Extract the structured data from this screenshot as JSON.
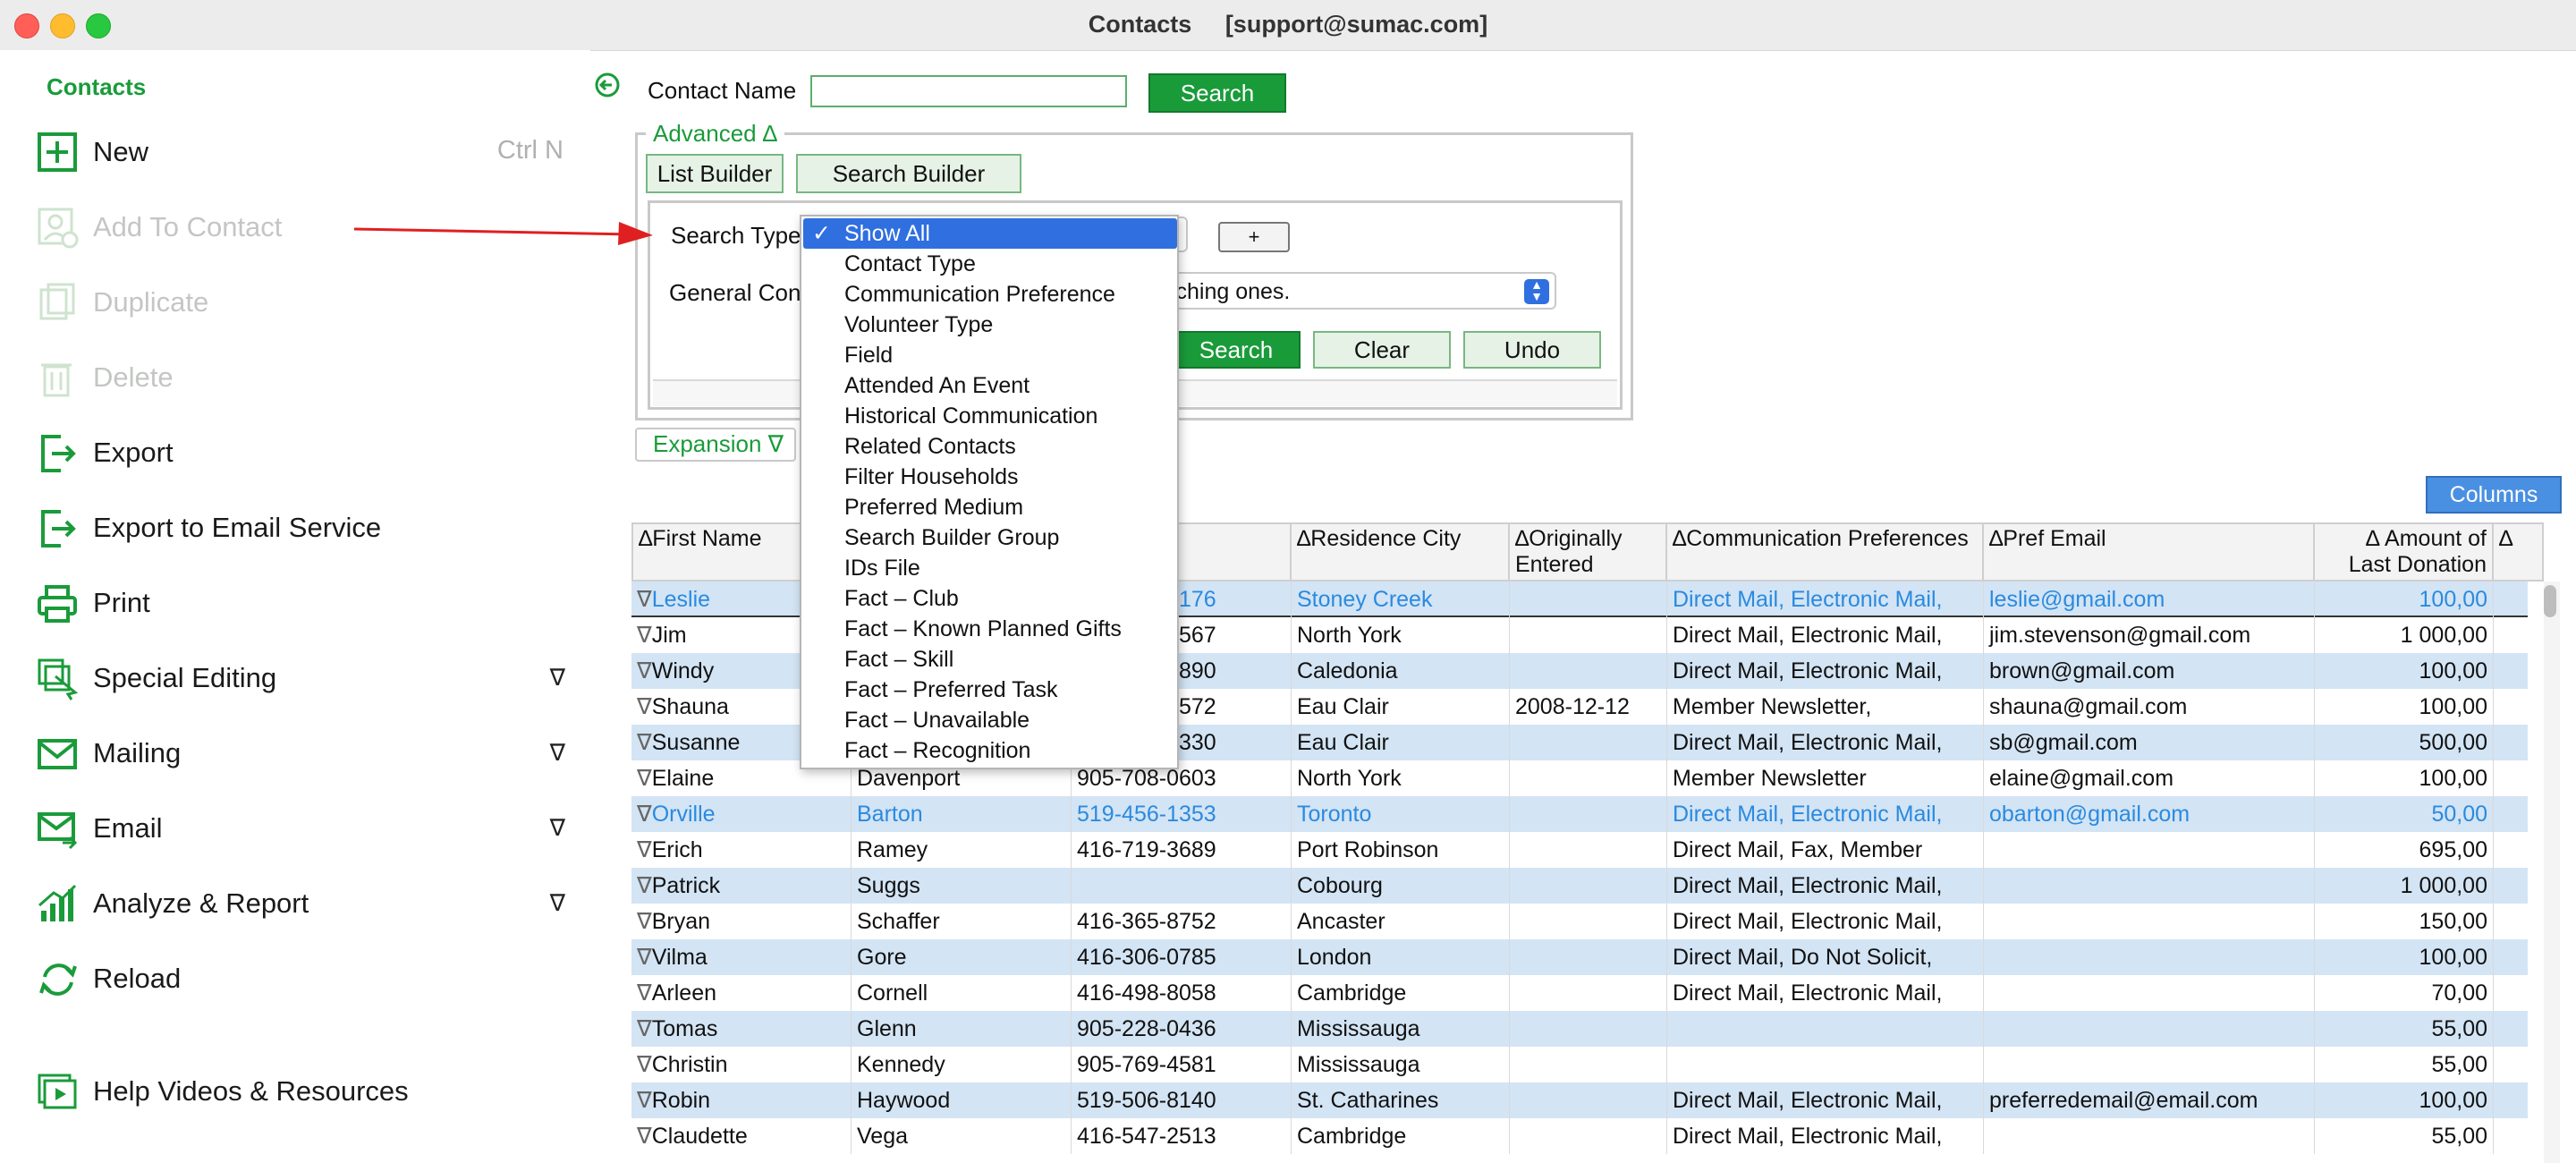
{
  "window": {
    "title": "Contacts     [support@sumac.com]"
  },
  "sidebar": {
    "header": "Contacts",
    "items": [
      {
        "label": "New",
        "shortcut": "Ctrl N",
        "icon": "plus-square-icon",
        "enabled": true
      },
      {
        "label": "Add To Contact",
        "icon": "add-person-icon",
        "enabled": false
      },
      {
        "label": "Duplicate",
        "icon": "duplicate-icon",
        "enabled": false
      },
      {
        "label": "Delete",
        "icon": "trash-icon",
        "enabled": false
      },
      {
        "label": "Export",
        "icon": "export-icon",
        "enabled": true
      },
      {
        "label": "Export to Email Service",
        "icon": "export-email-icon",
        "enabled": true
      },
      {
        "label": "Print",
        "icon": "printer-icon",
        "enabled": true
      },
      {
        "label": "Special Editing",
        "icon": "special-edit-icon",
        "enabled": true,
        "submenu": "∇"
      },
      {
        "label": "Mailing",
        "icon": "mail-icon",
        "enabled": true,
        "submenu": "∇"
      },
      {
        "label": "Email",
        "icon": "email-icon",
        "enabled": true,
        "submenu": "∇"
      },
      {
        "label": "Analyze & Report",
        "icon": "bar-chart-icon",
        "enabled": true,
        "submenu": "∇"
      },
      {
        "label": "Reload",
        "icon": "reload-icon",
        "enabled": true
      },
      {
        "label": "Help Videos & Resources",
        "icon": "video-icon",
        "enabled": true
      }
    ]
  },
  "search": {
    "contact_name_label": "Contact Name",
    "contact_name_value": "",
    "search_button": "Search",
    "advanced_label": "Advanced ∆",
    "list_builder": "List Builder",
    "search_builder": "Search Builder",
    "search_type_label": "Search Type",
    "general_label": "General Cont",
    "plus_button": "+",
    "general_select_text": "only matching ones.",
    "search_button2": "Search",
    "clear_button": "Clear",
    "undo_button": "Undo",
    "expansion_label": "Expansion ∇",
    "columns_button": "Columns"
  },
  "dropdown": {
    "check": "✓",
    "selected_index": 0,
    "options": [
      "Show All",
      "Contact Type",
      "Communication Preference",
      "Volunteer Type",
      "Field",
      "Attended An Event",
      "Historical Communication",
      "Related Contacts",
      "Filter Households",
      "Preferred Medium",
      "Search Builder Group",
      "IDs File",
      "Fact – Club",
      "Fact – Known Planned Gifts",
      "Fact – Skill",
      "Fact – Preferred Task",
      "Fact – Unavailable",
      "Fact – Recognition"
    ]
  },
  "table": {
    "headers": [
      "∆First Name",
      "",
      "∆Phone",
      "∆Residence City",
      "∆Originally Entered",
      "∆Communication Preferences",
      "∆Pref Email",
      "∆      Amount of Last Donation",
      "∆"
    ],
    "rows": [
      {
        "first": "Leslie",
        "last": "",
        "phone": "416-456-6176",
        "city": "Stoney Creek",
        "entered": "",
        "comm": "Direct Mail, Electronic Mail,",
        "email": "leslie@gmail.com",
        "amount": "100,00",
        "blue": true,
        "selected": true
      },
      {
        "first": "Jim",
        "last": "",
        "phone": "416-456-4567",
        "city": "North York",
        "entered": "",
        "comm": "Direct Mail, Electronic Mail,",
        "email": "jim.stevenson@gmail.com",
        "amount": "1 000,00"
      },
      {
        "first": "Windy",
        "last": "",
        "phone": "123-456-7890",
        "city": "Caledonia",
        "entered": "",
        "comm": "Direct Mail, Electronic Mail,",
        "email": "brown@gmail.com",
        "amount": "100,00"
      },
      {
        "first": "Shauna",
        "last": "",
        "phone": "905-169-2572",
        "city": "Eau Clair",
        "entered": "2008-12-12",
        "comm": "Member Newsletter,",
        "email": "shauna@gmail.com",
        "amount": "100,00"
      },
      {
        "first": "Susanne",
        "last": "",
        "phone": "416-713-1330",
        "city": "Eau Clair",
        "entered": "",
        "comm": "Direct Mail, Electronic Mail,",
        "email": "sb@gmail.com",
        "amount": "500,00"
      },
      {
        "first": "Elaine",
        "last": "Davenport",
        "phone": "905-708-0603",
        "city": "North York",
        "entered": "",
        "comm": "Member Newsletter",
        "email": "elaine@gmail.com",
        "amount": "100,00"
      },
      {
        "first": "Orville",
        "last": "Barton",
        "phone": "519-456-1353",
        "city": "Toronto",
        "entered": "",
        "comm": "Direct Mail, Electronic Mail,",
        "email": "obarton@gmail.com",
        "amount": "50,00",
        "blue": true
      },
      {
        "first": "Erich",
        "last": "Ramey",
        "phone": "416-719-3689",
        "city": "Port Robinson",
        "entered": "",
        "comm": "Direct Mail, Fax, Member",
        "email": "",
        "amount": "695,00"
      },
      {
        "first": "Patrick",
        "last": "Suggs",
        "phone": "",
        "city": "Cobourg",
        "entered": "",
        "comm": "Direct Mail, Electronic Mail,",
        "email": "",
        "amount": "1 000,00"
      },
      {
        "first": "Bryan",
        "last": "Schaffer",
        "phone": "416-365-8752",
        "city": "Ancaster",
        "entered": "",
        "comm": "Direct Mail, Electronic Mail,",
        "email": "",
        "amount": "150,00"
      },
      {
        "first": "Vilma",
        "last": "Gore",
        "phone": "416-306-0785",
        "city": "London",
        "entered": "",
        "comm": "Direct Mail, Do Not Solicit,",
        "email": "",
        "amount": "100,00"
      },
      {
        "first": "Arleen",
        "last": "Cornell",
        "phone": "416-498-8058",
        "city": "Cambridge",
        "entered": "",
        "comm": "Direct Mail, Electronic Mail,",
        "email": "",
        "amount": "70,00"
      },
      {
        "first": "Tomas",
        "last": "Glenn",
        "phone": "905-228-0436",
        "city": "Mississauga",
        "entered": "",
        "comm": "",
        "email": "",
        "amount": "55,00"
      },
      {
        "first": "Christin",
        "last": "Kennedy",
        "phone": "905-769-4581",
        "city": "Mississauga",
        "entered": "",
        "comm": "",
        "email": "",
        "amount": "55,00"
      },
      {
        "first": "Robin",
        "last": "Haywood",
        "phone": "519-506-8140",
        "city": "St. Catharines",
        "entered": "",
        "comm": "Direct Mail, Electronic Mail,",
        "email": "preferredemail@email.com",
        "amount": "100,00"
      },
      {
        "first": "Claudette",
        "last": "Vega",
        "phone": "416-547-2513",
        "city": "Cambridge",
        "entered": "",
        "comm": "Direct Mail, Electronic Mail,",
        "email": "",
        "amount": "55,00"
      }
    ],
    "row_marker": "∇"
  },
  "colors": {
    "accent_green": "#1a9b3a",
    "link_blue": "#2a8ae0",
    "row_alt": "#d3e4f4",
    "select_blue": "#2f6fe0",
    "arrow_red": "#e02020"
  }
}
